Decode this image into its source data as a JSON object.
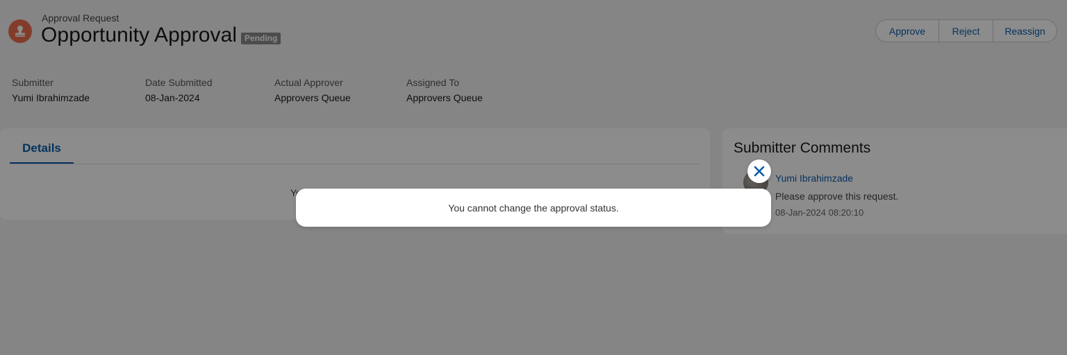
{
  "header": {
    "object_label": "Approval Request",
    "title": "Opportunity Approval",
    "status_badge": "Pending",
    "actions": {
      "approve": "Approve",
      "reject": "Reject",
      "reassign": "Reassign"
    }
  },
  "highlights": [
    {
      "label": "Submitter",
      "value": "Yumi Ibrahimzade"
    },
    {
      "label": "Date Submitted",
      "value": "08-Jan-2024"
    },
    {
      "label": "Actual Approver",
      "value": "Approvers Queue"
    },
    {
      "label": "Assigned To",
      "value": "Approvers Queue"
    }
  ],
  "details": {
    "tab_label": "Details",
    "partially_hidden_text": "Yo"
  },
  "comments": {
    "title": "Submitter Comments",
    "author": "Yumi Ibrahimzade",
    "text": "Please approve this request.",
    "date": "08-Jan-2024 08:20:10"
  },
  "toast": {
    "message": "You cannot change the approval status.",
    "close_icon": "close-icon"
  },
  "colors": {
    "brand_blue": "#0b5cab",
    "header_icon": "#ef6e4d",
    "badge": "#8a8a8a",
    "overlay": "rgba(0,0,0,0.45)"
  }
}
